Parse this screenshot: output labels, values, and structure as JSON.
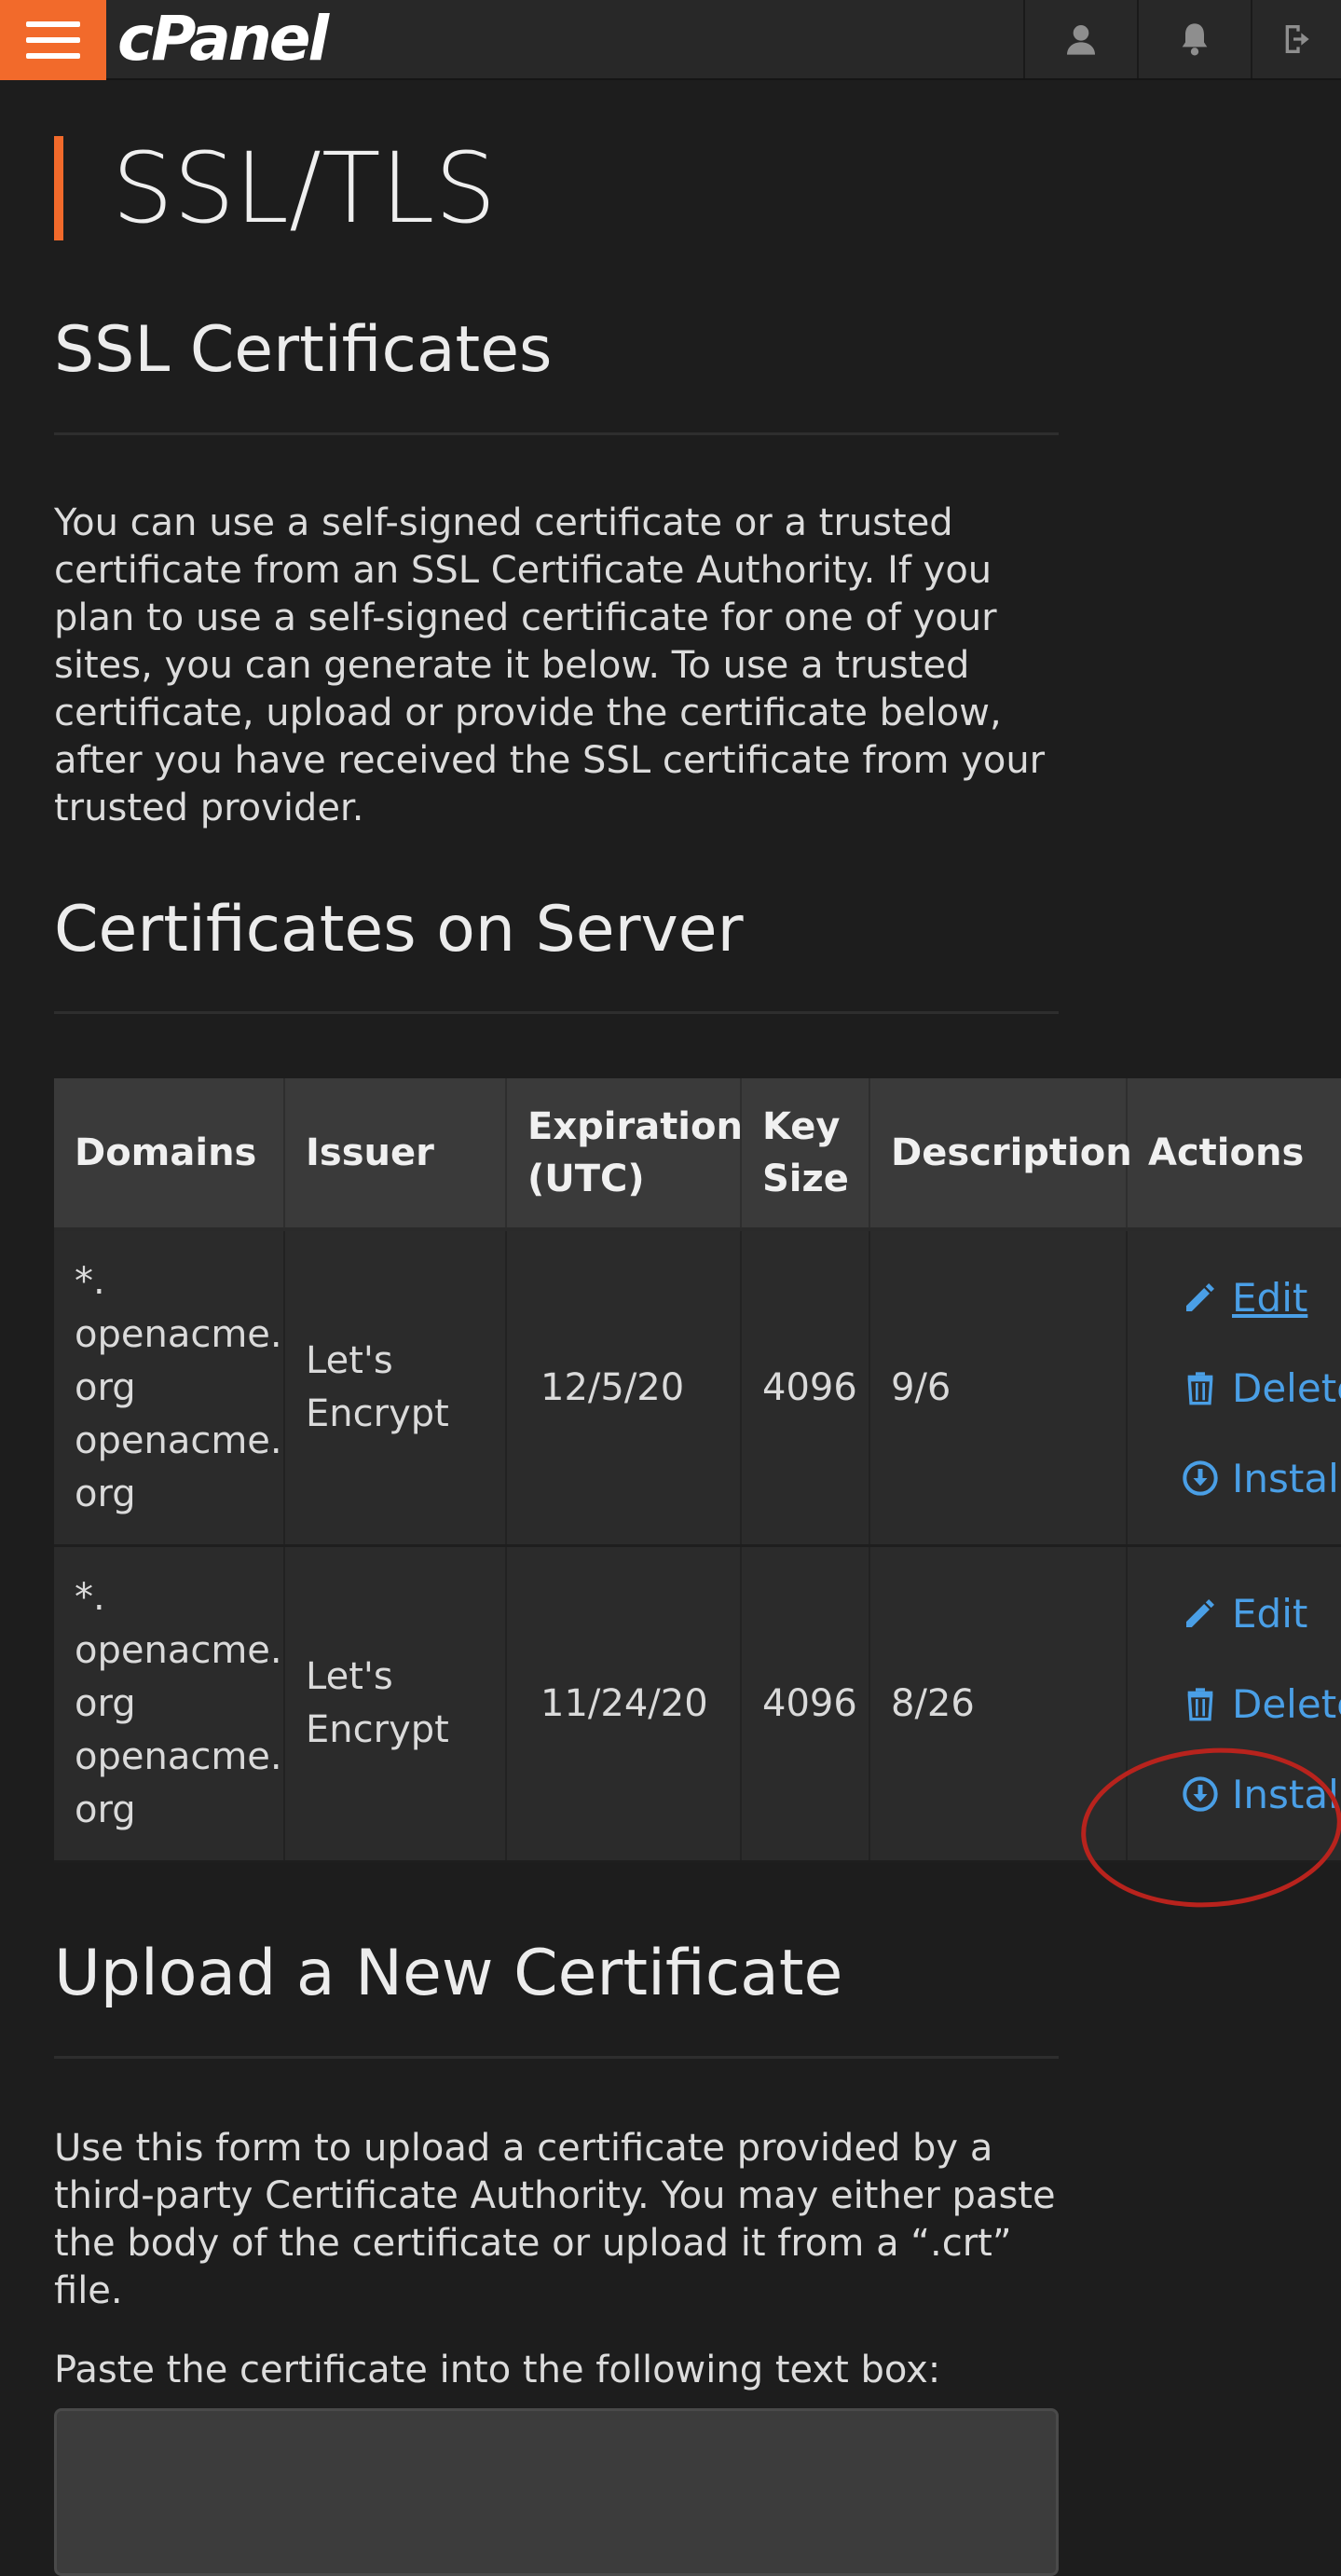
{
  "topbar": {
    "brand": "cPanel",
    "icons": [
      "user-icon",
      "bell-icon",
      "logout-icon"
    ]
  },
  "page": {
    "title": "SSL/TLS"
  },
  "ssl_certificates": {
    "heading": "SSL Certificates",
    "description": "You can use a self-signed certificate or a trusted certificate from an SSL Certificate Authority. If you plan to use a self-signed certificate for one of your sites, you can generate it below. To use a trusted certificate, upload or provide the certificate below, after you have received the SSL certificate from your trusted provider."
  },
  "certs_on_server": {
    "heading": "Certificates on Server",
    "columns": [
      "Domains",
      "Issuer",
      "Expiration (UTC)",
      "Key Size",
      "Description",
      "Actions"
    ],
    "rows": [
      {
        "domains": "*. openacme. org openacme. org",
        "issuer": "Let's Encrypt",
        "expiration": "12/5/20",
        "key_size": "4096",
        "description": "9/6",
        "actions": [
          "Edit",
          "Delete",
          "Install"
        ]
      },
      {
        "domains": "*. openacme. org openacme. org",
        "issuer": "Let's Encrypt",
        "expiration": "11/24/20",
        "key_size": "4096",
        "description": "8/26",
        "actions": [
          "Edit",
          "Delete",
          "Install"
        ]
      }
    ]
  },
  "upload": {
    "heading": "Upload a New Certificate",
    "description": "Use this form to upload a certificate provided by a third-party Certificate Authority. You may either paste the body of the certificate or upload it from a “.crt” file.",
    "paste_label": "Paste the certificate into the following text box:",
    "textbox_value": ""
  },
  "colors": {
    "accent": "#f26a2b",
    "link": "#4a9fe6",
    "annotation": "#b8231d",
    "background": "#1d1d1d"
  }
}
